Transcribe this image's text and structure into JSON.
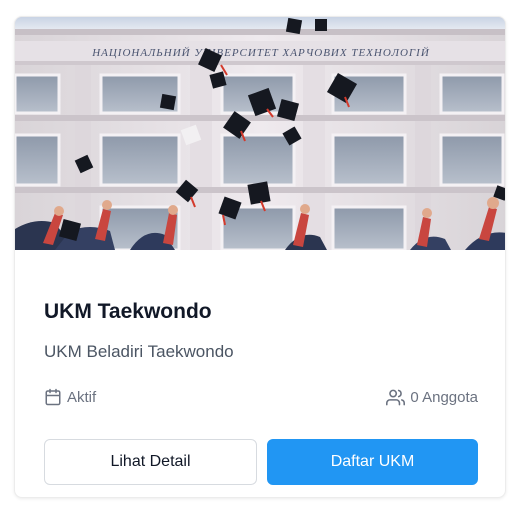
{
  "card": {
    "image_alt": "graduation caps thrown in front of university building",
    "banner_text": "НАЦІОНАЛЬНИЙ УНІВЕРСИТЕТ ХАРЧОВИХ ТЕХНОЛОГІЙ",
    "title": "UKM Taekwondo",
    "description": "UKM Beladiri Taekwondo",
    "status_icon": "calendar-icon",
    "status": "Aktif",
    "members_icon": "users-icon",
    "members": "0 Anggota",
    "detail_button": "Lihat Detail",
    "join_button": "Daftar UKM"
  },
  "colors": {
    "primary": "#2196f3",
    "title": "#111827",
    "muted": "#6b7280",
    "border": "#d7dbe0"
  }
}
